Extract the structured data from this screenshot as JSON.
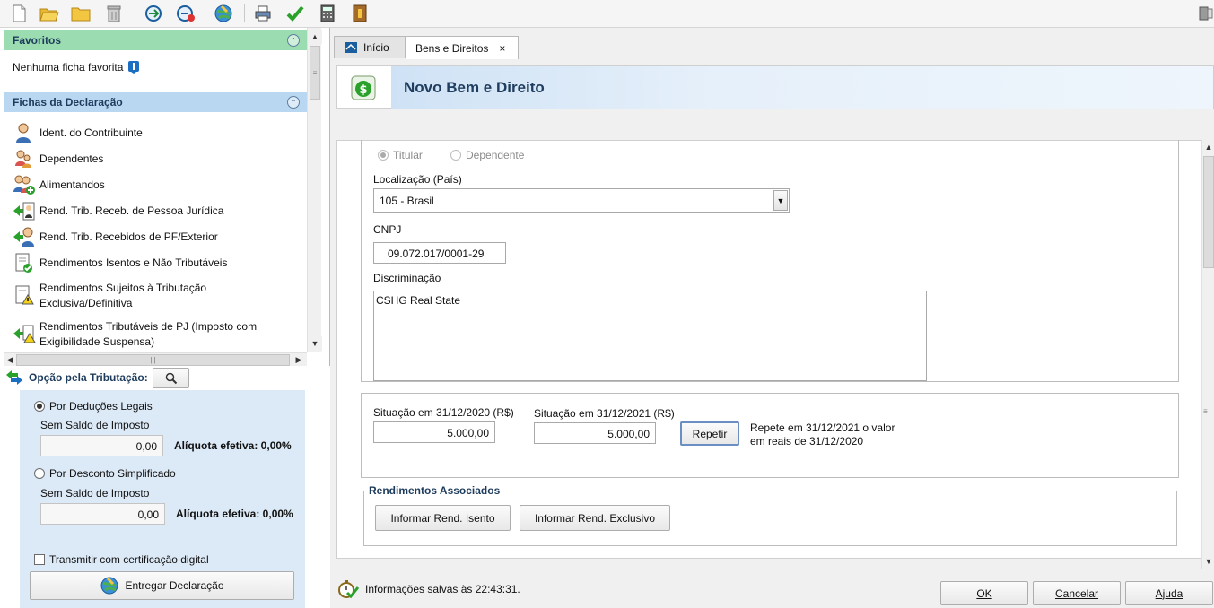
{
  "toolbar": {
    "icons": [
      "new-file-icon",
      "open-folder-icon",
      "folder-icon",
      "trash-icon",
      "receita-import-icon",
      "receita-export-icon",
      "globe-transmit-icon",
      "printer-icon",
      "check-icon",
      "calculator-icon",
      "help-book-icon",
      "exit-icon"
    ]
  },
  "favoritos": {
    "title": "Favoritos",
    "empty_text": "Nenhuma ficha favorita"
  },
  "fichas": {
    "title": "Fichas da Declaração",
    "items": [
      {
        "label": "Ident. do Contribuinte"
      },
      {
        "label": "Dependentes"
      },
      {
        "label": "Alimentandos"
      },
      {
        "label": "Rend. Trib. Receb. de Pessoa Jurídica"
      },
      {
        "label": "Rend. Trib. Recebidos de PF/Exterior"
      },
      {
        "label": "Rendimentos Isentos e Não Tributáveis"
      },
      {
        "label": "Rendimentos Sujeitos à Tributação Exclusiva/Definitiva"
      },
      {
        "label": "Rendimentos Tributáveis de PJ (Imposto com Exigibilidade Suspensa)"
      }
    ]
  },
  "tributacao": {
    "title": "Opção pela Tributação:",
    "options": [
      {
        "label": "Por Deduções Legais",
        "selected": true,
        "sublabel": "Sem Saldo de Imposto",
        "value": "0,00",
        "rate": "Alíquota efetiva: 0,00%"
      },
      {
        "label": "Por Desconto Simplificado",
        "selected": false,
        "sublabel": "Sem Saldo de Imposto",
        "value": "0,00",
        "rate": "Alíquota efetiva: 0,00%"
      }
    ],
    "cert_label": "Transmitir com certificação digital",
    "cert_checked": false,
    "submit_label": "Entregar Declaração"
  },
  "tabs": [
    {
      "label": "Início",
      "active": false
    },
    {
      "label": "Bens e Direitos",
      "active": true,
      "close": "×"
    }
  ],
  "form": {
    "title": "Novo Bem e Direito",
    "owner_options": [
      {
        "label": "Titular",
        "selected": true
      },
      {
        "label": "Dependente",
        "selected": false
      }
    ],
    "location_label": "Localização (País)",
    "location_value": "105 - Brasil",
    "cnpj_label": "CNPJ",
    "cnpj_value": "09.072.017/0001-29",
    "description_label": "Discriminação",
    "description_value": "CSHG Real State",
    "situation_2020_label": "Situação em 31/12/2020 (R$)",
    "situation_2020_value": "5.000,00",
    "situation_2021_label": "Situação em 31/12/2021 (R$)",
    "situation_2021_value": "5.000,00",
    "repeat_label": "Repetir",
    "repeat_hint_line1": "Repete em 31/12/2021 o valor",
    "repeat_hint_line2": "em reais de 31/12/2020",
    "rendimentos_title": "Rendimentos Associados",
    "rend_isento_label": "Informar Rend. Isento",
    "rend_exclusivo_label": "Informar Rend. Exclusivo"
  },
  "status": {
    "text": "Informações salvas às 22:43:31."
  },
  "footer": {
    "ok_label": "OK",
    "cancel_label": "Cancelar",
    "help_label": "Ajuda"
  },
  "colors": {
    "favoritos_header": "#9bdcb0",
    "fichas_header": "#b9d7f1",
    "header_title": "#1f3d5e",
    "tributacao_box": "#dce9f6"
  }
}
